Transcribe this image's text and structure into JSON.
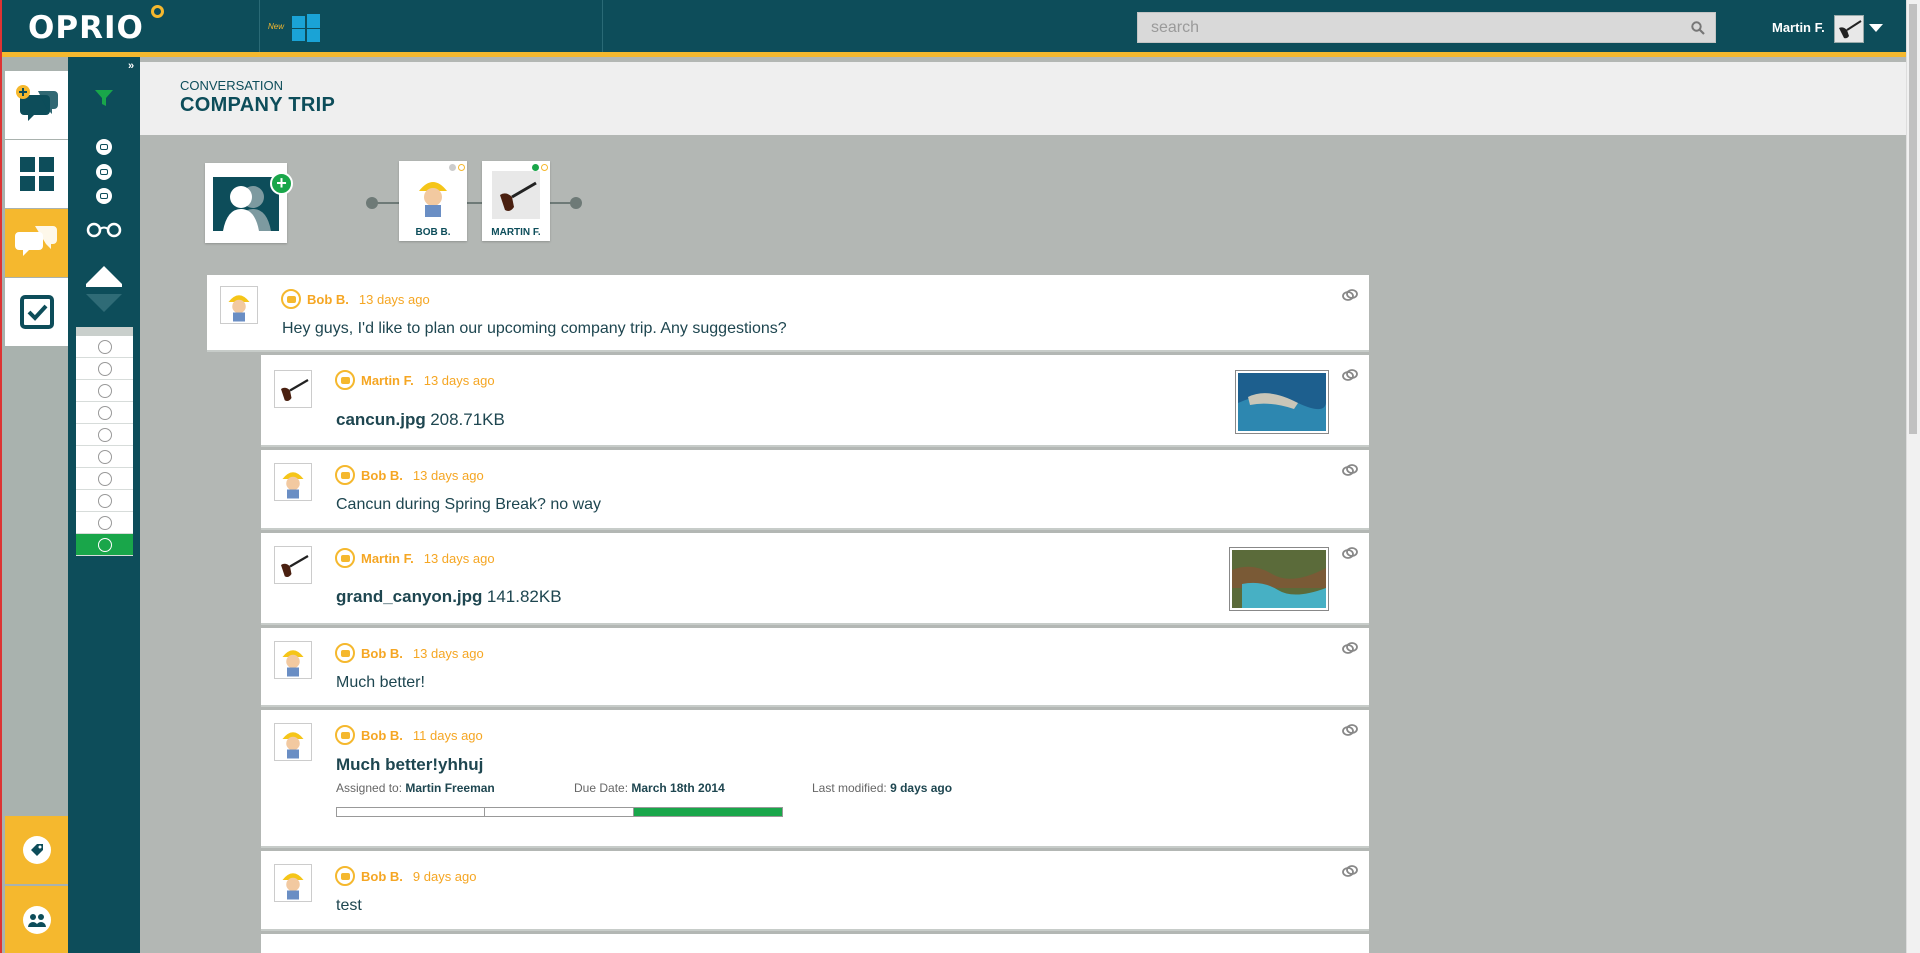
{
  "app": {
    "logo": "OPRIO",
    "new_label": "New",
    "search_placeholder": "search",
    "user_name": "Martin F."
  },
  "colors": {
    "brand_dark": "#0d4d5a",
    "accent": "#f5b82e",
    "success": "#19a64a"
  },
  "sidebar": {
    "main_buttons": [
      "new-conversation-icon",
      "dashboard-icon",
      "conversations-icon",
      "tasks-icon"
    ],
    "bottom_buttons": [
      "tags-icon",
      "people-icon"
    ]
  },
  "filter_panel": {
    "icons": [
      "filter-icon",
      "chat-filter-icon",
      "task-filter-icon",
      "file-filter-icon",
      "glasses-icon"
    ]
  },
  "header": {
    "label": "CONVERSATION",
    "title": "COMPANY TRIP"
  },
  "participants": [
    {
      "name": "BOB B.",
      "avatar": "bob-avatar"
    },
    {
      "name": "MARTIN F.",
      "avatar": "pipe-avatar"
    }
  ],
  "messages": [
    {
      "author": "Bob B.",
      "time": "13 days ago",
      "text": "Hey guys, I'd like to plan our upcoming company trip.  Any suggestions?"
    },
    {
      "author": "Martin F.",
      "time": "13 days ago",
      "file_name": "cancun.jpg",
      "file_size": "208.71KB"
    },
    {
      "author": "Bob B.",
      "time": "13 days ago",
      "text": "Cancun during Spring Break? no way"
    },
    {
      "author": "Martin F.",
      "time": "13 days ago",
      "file_name": "grand_canyon.jpg",
      "file_size": "141.82KB"
    },
    {
      "author": "Bob B.",
      "time": "13 days ago",
      "text": "Much better!"
    },
    {
      "author": "Bob B.",
      "time": "11 days ago",
      "task_title": "Much better!yhhuj",
      "assigned_label": "Assigned to:",
      "assigned_value": "Martin Freeman",
      "due_label": "Due Date:",
      "due_value": "March 18th 2014",
      "modified_label": "Last modified:",
      "modified_value": "9 days ago",
      "progress_segments": 3,
      "progress_done": 1
    },
    {
      "author": "Bob B.",
      "time": "9 days ago",
      "text": "test"
    }
  ]
}
